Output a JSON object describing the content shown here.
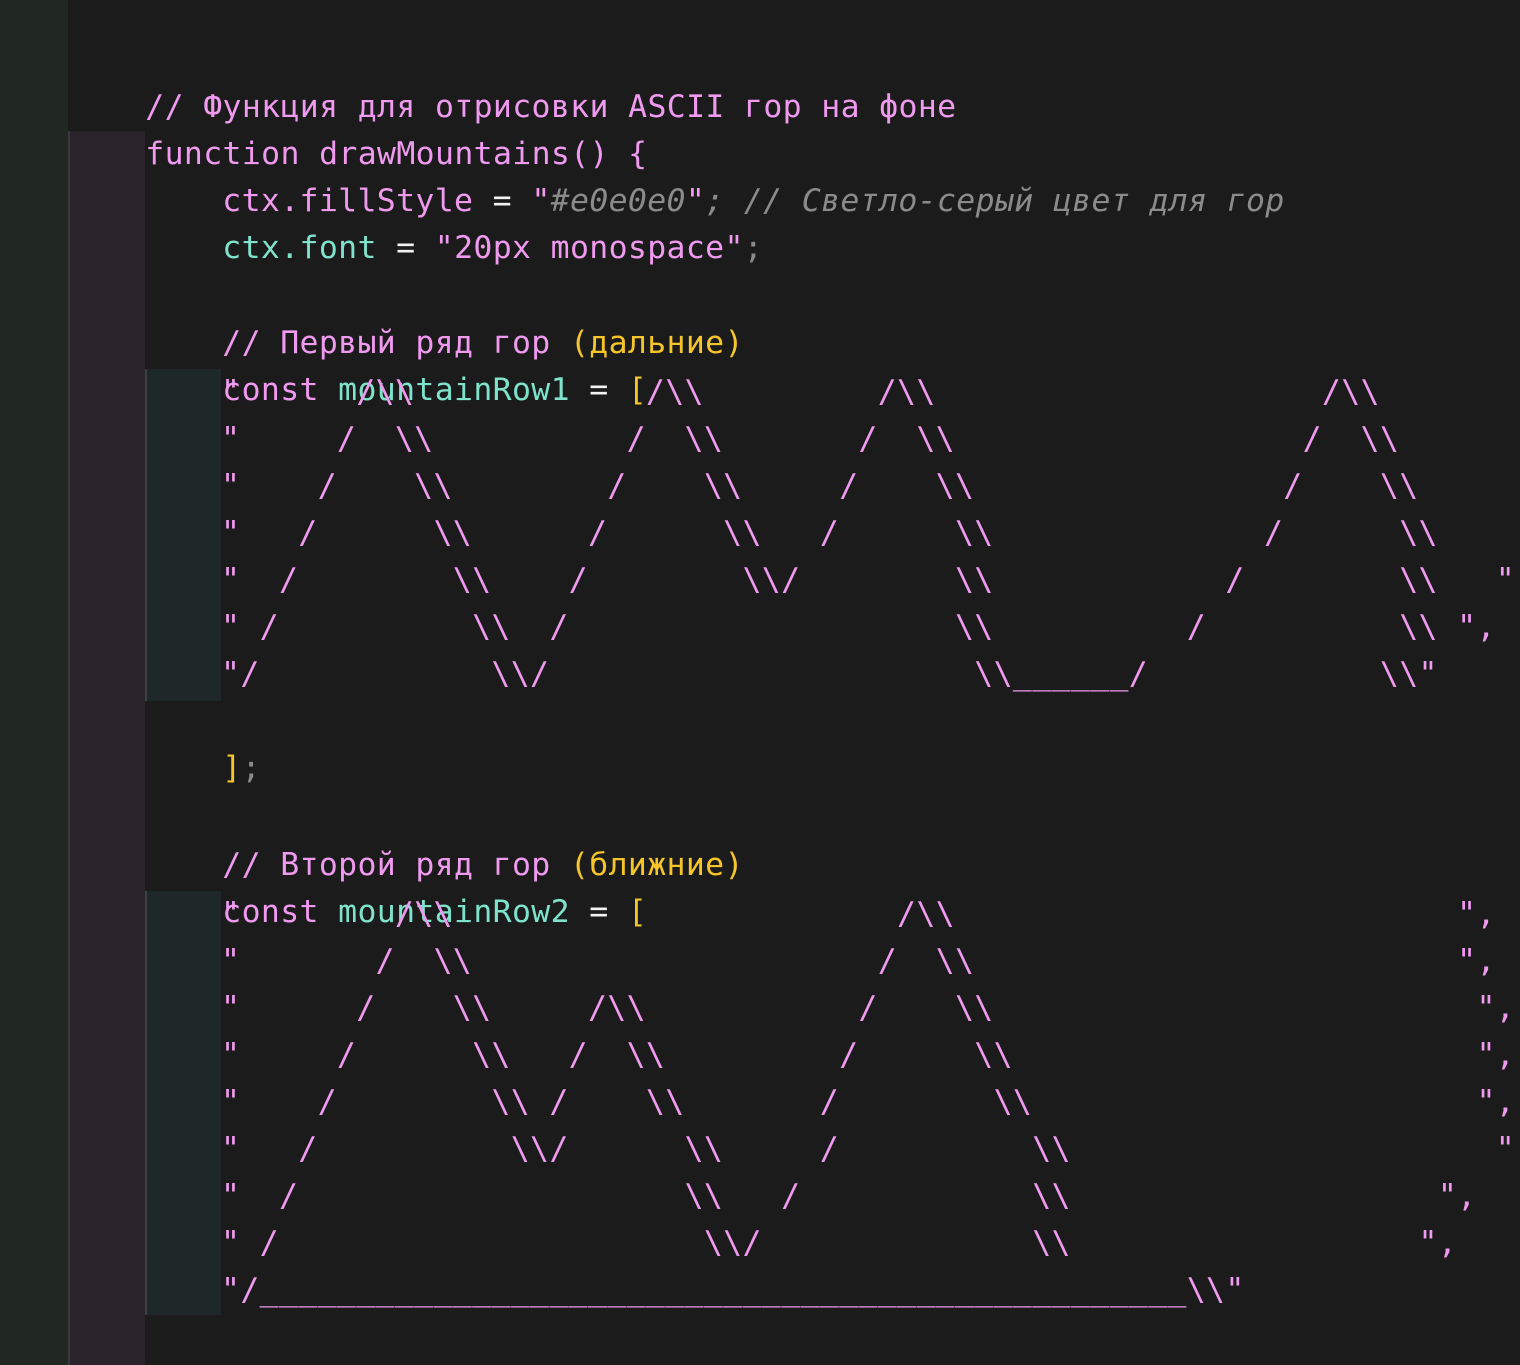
{
  "code": {
    "header_comment": "// Функция для отрисовки ASCII гор на фоне",
    "function_keyword": "function",
    "function_name": " drawMountains",
    "function_sig_rest": "() {",
    "line_fill": {
      "obj": "ctx.fillStyle",
      "eq": " = ",
      "quote_open": "\"",
      "value": "#e0e0e0",
      "quote_close": "\"",
      "semicolon": ";",
      "comment": " // Светло-серый цвет для гор"
    },
    "line_font": {
      "obj": "ctx.font",
      "eq": " = ",
      "value": "\"20px monospace\"",
      "semicolon": ";"
    },
    "row1_comment_a": "// Первый ряд гор ",
    "row1_comment_b": "(дальние)",
    "row1_decl": {
      "keyword": "const",
      "name": " mountainRow1",
      "eq": " = ",
      "bracket": "["
    },
    "row1_lines": [
      "\"      /\\\\            /\\\\         /\\\\                    /\\\\       \",",
      "\"     /  \\\\          /  \\\\       /  \\\\                  /  \\\\      \",",
      "\"    /    \\\\        /    \\\\     /    \\\\                /    \\\\     \",",
      "\"   /      \\\\      /      \\\\   /      \\\\              /      \\\\    \",",
      "\"  /        \\\\    /        \\\\/        \\\\            /        \\\\   \",",
      "\" /          \\\\  /                    \\\\          /          \\\\ \",",
      "\"/            \\\\/                      \\\\______/            \\\\\""
    ],
    "row1_close": "]",
    "row1_close_semicolon": ";",
    "row2_comment_a": "// Второй ряд гор ",
    "row2_comment_b": "(ближние)",
    "row2_decl": {
      "keyword": "const",
      "name": " mountainRow2",
      "eq": " = ",
      "bracket": "["
    },
    "row2_lines": [
      "\"        /\\\\                       /\\\\                          \",",
      "\"       /  \\\\                     /  \\\\                         \",",
      "\"      /    \\\\     /\\\\           /    \\\\                         \",",
      "\"     /      \\\\   /  \\\\         /      \\\\                        \",",
      "\"    /        \\\\ /    \\\\       /        \\\\                       \",",
      "\"   /          \\\\/      \\\\     /          \\\\                      \",",
      "\"  /                    \\\\   /            \\\\                   \",",
      "\" /                      \\\\/              \\\\                  \",",
      "\"/________________________________________________\\\\\""
    ]
  }
}
